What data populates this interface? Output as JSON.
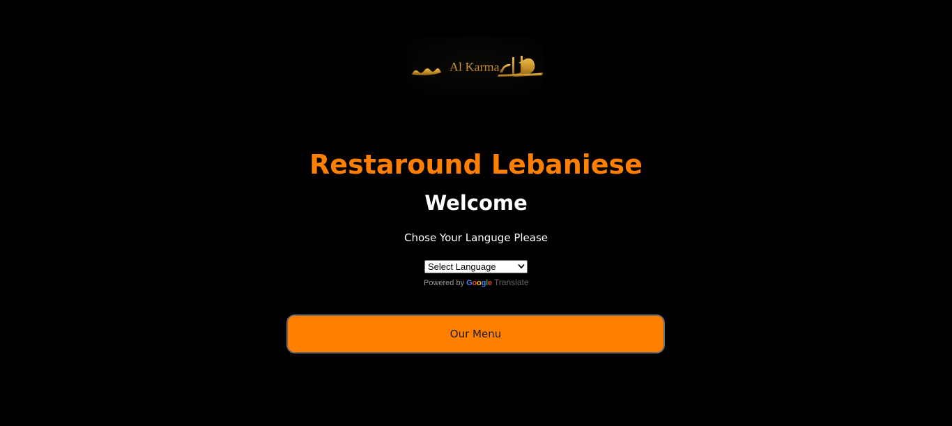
{
  "logo": {
    "text_latin": "Al Karma",
    "text_arabic": "الكرمه",
    "color": "#c8962e"
  },
  "header": {
    "title": "Restaround Lebaniese",
    "subtitle": "Welcome"
  },
  "language": {
    "prompt": "Chose Your Languge Please",
    "select_value": "Select Language",
    "powered_by": "Powered by",
    "google": [
      "G",
      "o",
      "o",
      "g",
      "l",
      "e"
    ],
    "translate": "Translate"
  },
  "actions": {
    "menu_label": "Our Menu"
  },
  "colors": {
    "accent": "#ff8000",
    "background": "#000000",
    "text": "#ffffff"
  }
}
